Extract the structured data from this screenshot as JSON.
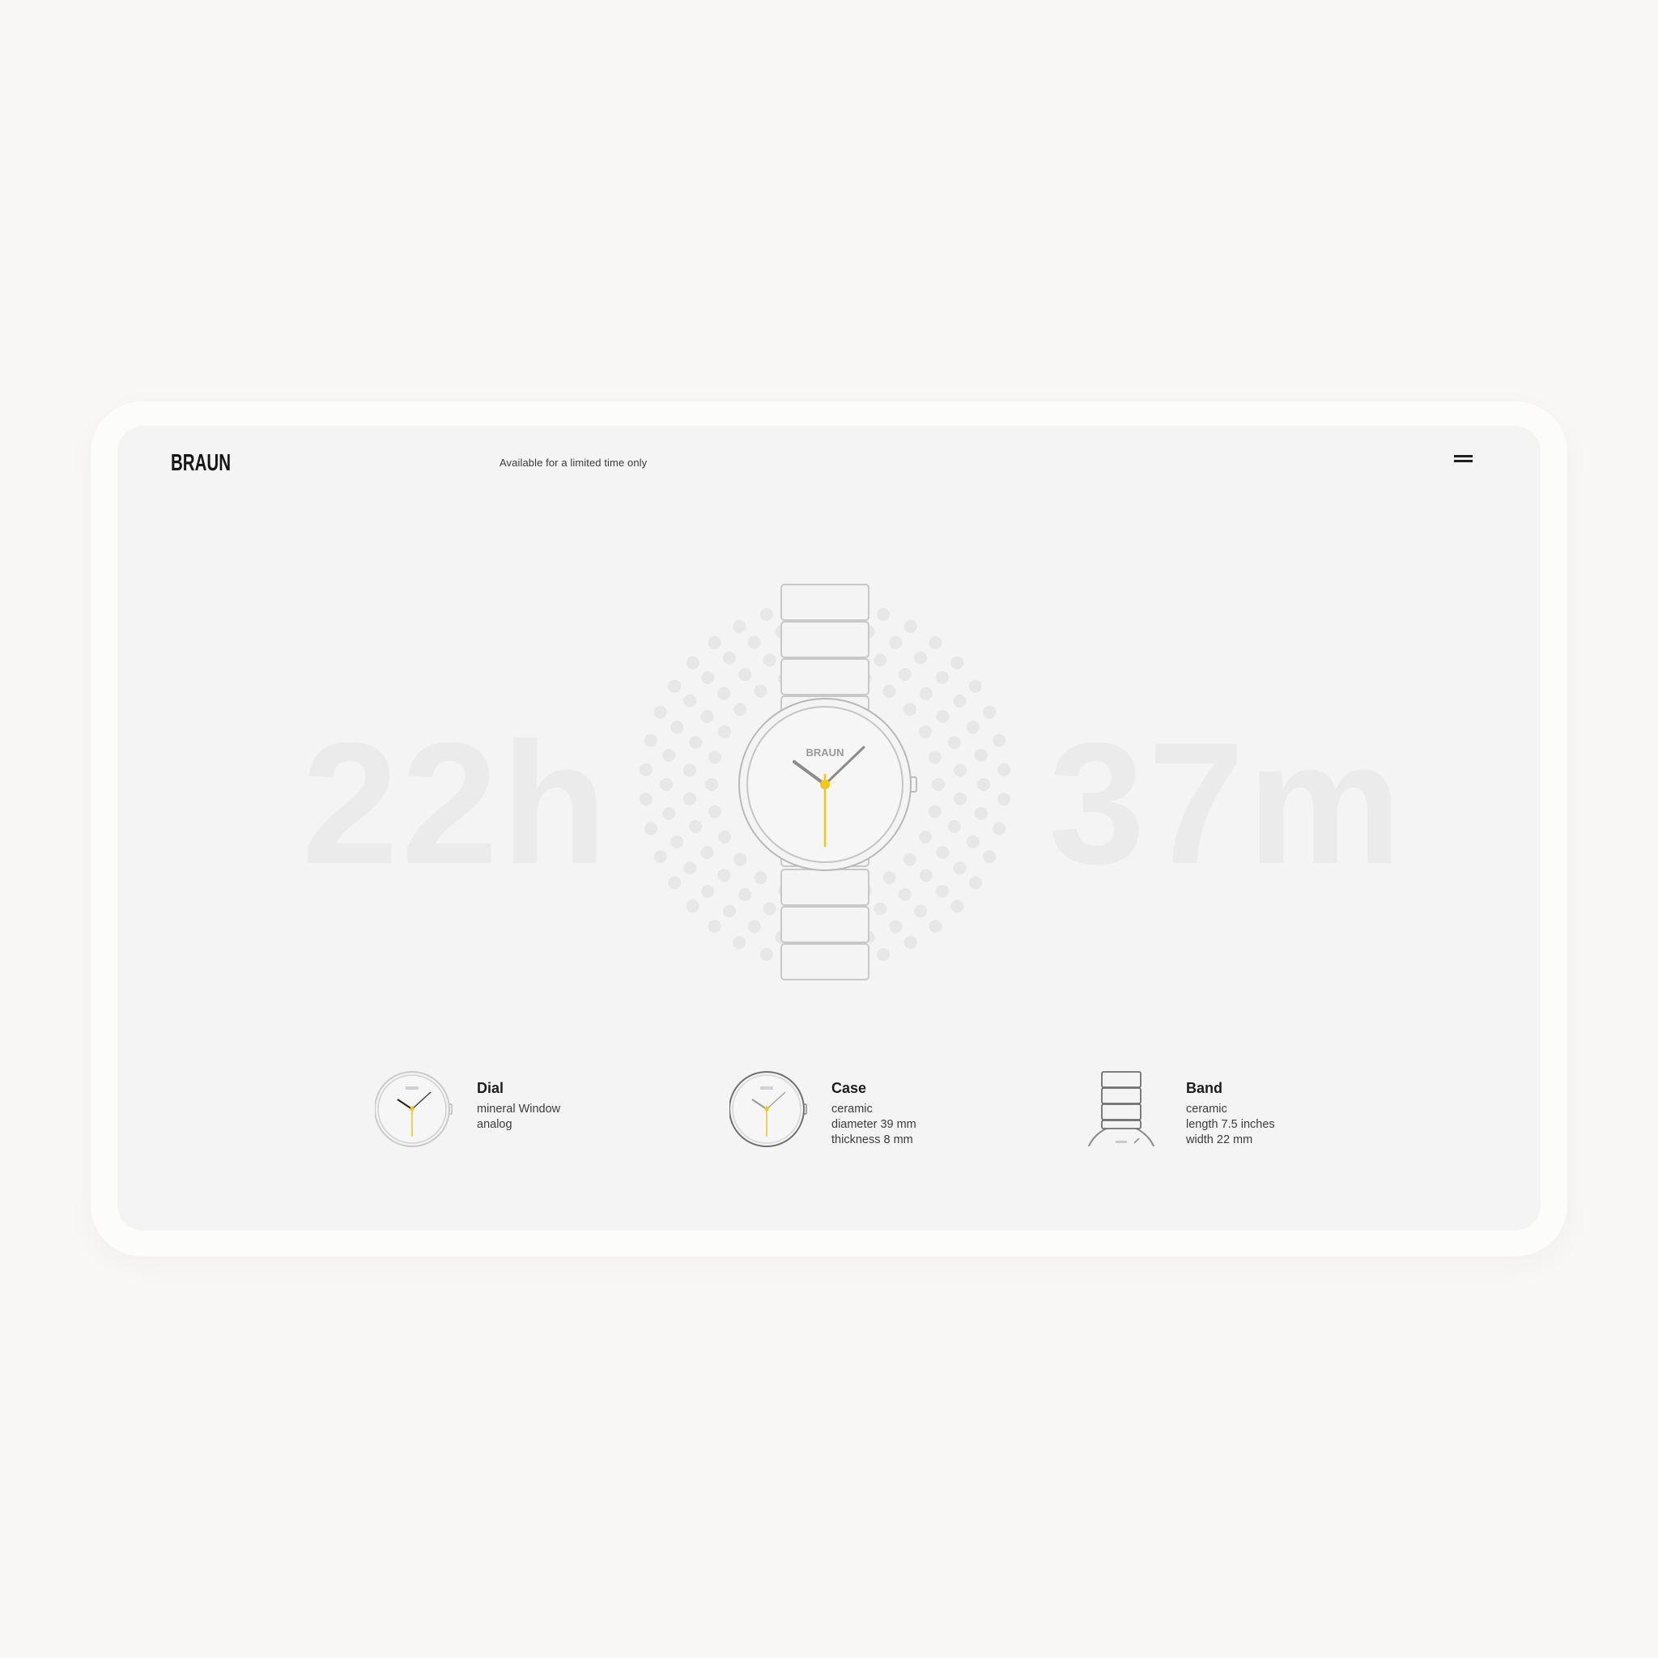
{
  "header": {
    "brand": "BRAUN",
    "tagline": "Available for a limited time only",
    "menu_icon": "hamburger-menu-icon"
  },
  "hero": {
    "hours_text": "22h",
    "minutes_text": "37m",
    "dial_brand": "BRAUN",
    "accent_color": "#f5c518"
  },
  "features": [
    {
      "title": "Dial",
      "lines": [
        "mineral Window",
        "analog"
      ],
      "icon": "watch-dial-icon"
    },
    {
      "title": "Case",
      "lines": [
        "ceramic",
        "diameter 39 mm",
        "thickness 8 mm"
      ],
      "icon": "watch-case-icon"
    },
    {
      "title": "Band",
      "lines": [
        "ceramic",
        "length 7.5 inches",
        "width 22 mm"
      ],
      "icon": "watch-band-icon"
    }
  ]
}
